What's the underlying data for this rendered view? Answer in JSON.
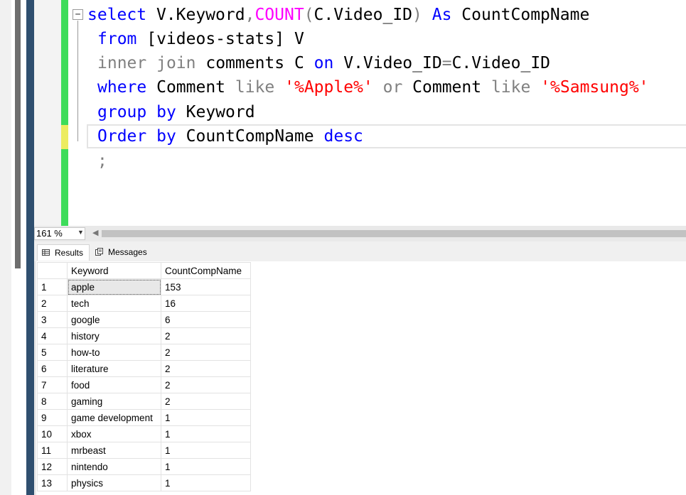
{
  "editor": {
    "zoom": "161 %",
    "code": {
      "l1": {
        "select": "select",
        "v_keyword": " V.Keyword",
        "comma": ",",
        "count": "COUNT",
        "open": "(",
        "c_video": "C.Video_ID",
        "close": ")",
        "as": " As",
        "alias": " CountCompName"
      },
      "l2": {
        "from": "from",
        "table": " [videos-stats] V"
      },
      "l3": {
        "inner": "inner",
        "join": " join",
        "comments": " comments C",
        "on": " on",
        "cond": " V.Video_ID",
        "eq": "=",
        "cond2": "C.Video_ID"
      },
      "l4": {
        "where": "where",
        "col1": " Comment",
        "like1": " like",
        "str1": " '%Apple%'",
        "or": " or",
        "col2": " Comment",
        "like2": " like",
        "str2": " '%Samsung%'"
      },
      "l5": {
        "group": "group",
        "by": " by",
        "col": " Keyword"
      },
      "l6": {
        "order": "Order",
        "by": " by",
        "col": " CountCompName",
        "desc": " desc"
      },
      "l7": {
        "semi": ";"
      }
    }
  },
  "tabs": {
    "results": "Results",
    "messages": "Messages"
  },
  "results": {
    "headers": [
      "Keyword",
      "CountCompName"
    ],
    "rows": [
      {
        "n": "1",
        "keyword": "apple",
        "count": "153"
      },
      {
        "n": "2",
        "keyword": "tech",
        "count": "16"
      },
      {
        "n": "3",
        "keyword": "google",
        "count": "6"
      },
      {
        "n": "4",
        "keyword": "history",
        "count": "2"
      },
      {
        "n": "5",
        "keyword": "how-to",
        "count": "2"
      },
      {
        "n": "6",
        "keyword": "literature",
        "count": "2"
      },
      {
        "n": "7",
        "keyword": "food",
        "count": "2"
      },
      {
        "n": "8",
        "keyword": "gaming",
        "count": "2"
      },
      {
        "n": "9",
        "keyword": "game development",
        "count": "1"
      },
      {
        "n": "10",
        "keyword": "xbox",
        "count": "1"
      },
      {
        "n": "11",
        "keyword": "mrbeast",
        "count": "1"
      },
      {
        "n": "12",
        "keyword": "nintendo",
        "count": "1"
      },
      {
        "n": "13",
        "keyword": "physics",
        "count": "1"
      }
    ]
  },
  "colors": {
    "keyword": "#0000ff",
    "function": "#ff00ff",
    "operator": "#808080",
    "string": "#ff0000",
    "change_bar": "#3ddc5a",
    "change_bar_unsaved": "#ecec60"
  }
}
